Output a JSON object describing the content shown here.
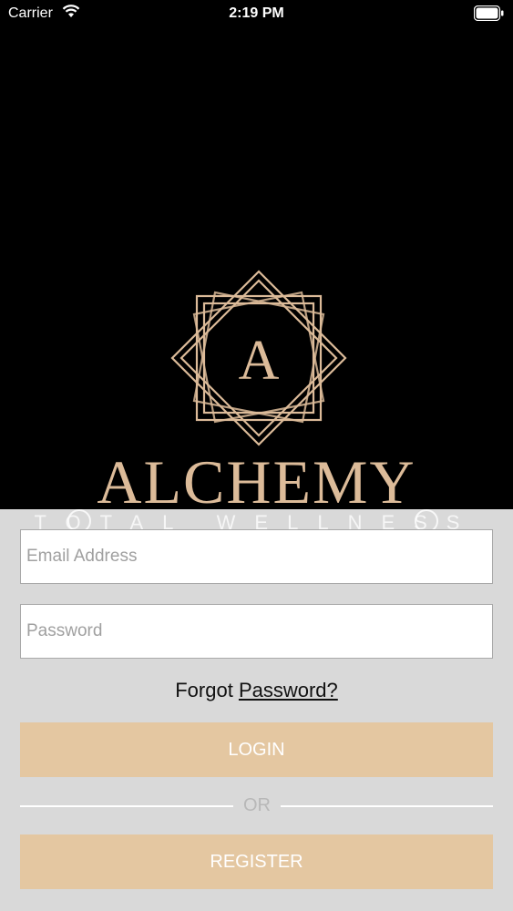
{
  "status_bar": {
    "carrier": "Carrier",
    "time": "2:19 PM"
  },
  "brand": {
    "monogram": "A",
    "name": "ALCHEMY",
    "tagline": "TOTAL WELLNESS",
    "logo_color": "#dcbb99"
  },
  "form": {
    "email_placeholder": "Email Address",
    "password_placeholder": "Password",
    "forgot_prefix": "Forgot",
    "forgot_link": "Password?",
    "login_label": "LOGIN",
    "or_label": "OR",
    "register_label": "REGISTER"
  },
  "colors": {
    "button_bg": "#e4c7a1",
    "panel_bg": "#d9d9d9"
  }
}
